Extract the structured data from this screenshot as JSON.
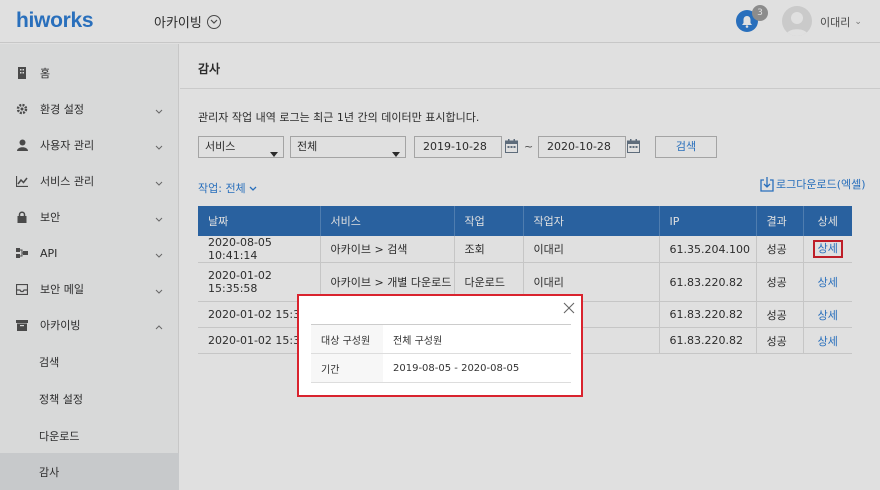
{
  "header": {
    "logo": "hiworks",
    "app_title": "아카이빙",
    "notification_count": "3",
    "user_name": "이대리"
  },
  "sidebar": {
    "items": [
      {
        "label": "홈"
      },
      {
        "label": "환경 설정"
      },
      {
        "label": "사용자 관리"
      },
      {
        "label": "서비스 관리"
      },
      {
        "label": "보안"
      },
      {
        "label": "API"
      },
      {
        "label": "보안 메일"
      },
      {
        "label": "아카이빙"
      }
    ],
    "sub_items": [
      {
        "label": "검색"
      },
      {
        "label": "정책 설정"
      },
      {
        "label": "다운로드"
      },
      {
        "label": "감사"
      }
    ]
  },
  "main": {
    "page_title": "감사",
    "notice": "관리자 작업 내역 로그는 최근 1년 간의 데이터만 표시합니다.",
    "service_select": "서비스",
    "scope_select": "전체",
    "date_from": "2019-10-28",
    "date_sep": "~",
    "date_to": "2020-10-28",
    "search_label": "검색",
    "filter_label": "작업: 전체",
    "download_label": "로그다운로드(엑셀)",
    "table": {
      "headers": [
        "날짜",
        "서비스",
        "작업",
        "작업자",
        "IP",
        "결과",
        "상세"
      ],
      "rows": [
        {
          "date": "2020-08-05 10:41:14",
          "service": "아카이브 > 검색",
          "action": "조회",
          "user": "이대리",
          "ip": "61.35.204.100",
          "result": "성공",
          "detail": "상세"
        },
        {
          "date": "2020-01-02 15:35:58",
          "service": "아카이브 > 개별 다운로드",
          "action": "다운로드",
          "user": "이대리",
          "ip": "61.83.220.82",
          "result": "성공",
          "detail": "상세"
        },
        {
          "date": "2020-01-02 15:35:5",
          "service": "",
          "action": "",
          "user": "",
          "ip": "61.83.220.82",
          "result": "성공",
          "detail": "상세"
        },
        {
          "date": "2020-01-02 15:35:4",
          "service": "",
          "action": "",
          "user": "",
          "ip": "61.83.220.82",
          "result": "성공",
          "detail": "상세"
        }
      ]
    }
  },
  "popup": {
    "rows": [
      {
        "key": "대상 구성원",
        "value": "전체 구성원"
      },
      {
        "key": "기간",
        "value": "2019-08-05 - 2020-08-05"
      }
    ]
  },
  "colors": {
    "accent": "#2f7fd6",
    "header_row": "#2f6fb5",
    "highlight": "#d9232e"
  }
}
